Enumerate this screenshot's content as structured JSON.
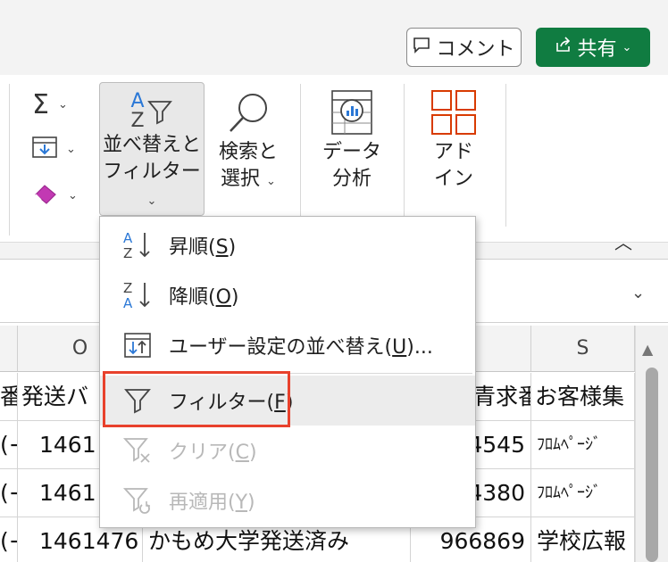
{
  "header": {
    "comment_label": "コメント",
    "share_label": "共有"
  },
  "ribbon": {
    "sort_filter_label": "並べ替えと",
    "sort_filter_label2": "フィルター",
    "find_select_label": "検索と",
    "find_select_label2": "選択",
    "analyze_label": "データ",
    "analyze_label2": "分析",
    "addins_label": "アド",
    "addins_label2": "イン",
    "sigma_glyph": "Σ",
    "sort_icon_top": "A",
    "sort_icon_bottom": "Z"
  },
  "menu": {
    "items": [
      {
        "label_pre": "昇順(",
        "key": "S",
        "label_post": ")",
        "icon": "sort-ascending-icon",
        "enabled": true
      },
      {
        "label_pre": "降順(",
        "key": "O",
        "label_post": ")",
        "icon": "sort-descending-icon",
        "enabled": true
      },
      {
        "label_pre": "ユーザー設定の並べ替え(",
        "key": "U",
        "label_post": ")...",
        "icon": "custom-sort-icon",
        "enabled": true
      },
      {
        "label_pre": "フィルター(",
        "key": "F",
        "label_post": ")",
        "icon": "filter-icon",
        "enabled": true
      },
      {
        "label_pre": "クリア(",
        "key": "C",
        "label_post": ")",
        "icon": "clear-filter-icon",
        "enabled": false
      },
      {
        "label_pre": "再適用(",
        "key": "Y",
        "label_post": ")",
        "icon": "reapply-filter-icon",
        "enabled": false
      }
    ]
  },
  "grid": {
    "columns": [
      "O",
      "S"
    ],
    "header_row": {
      "a": "番",
      "b": "発送バ",
      "c": "青求番",
      "d": "お客様集"
    },
    "rows": [
      {
        "a": "(+",
        "b": "1461",
        "c": "4545",
        "d": "ﾌﾛﾑﾍﾟｰｼﾞ"
      },
      {
        "a": "(+",
        "b": "1461",
        "c": "4380",
        "d": "ﾌﾛﾑﾍﾟｰｼﾞ"
      },
      {
        "a": "(+",
        "b": "1461476",
        "mid": "かもめ大学発送済み",
        "c": "966869",
        "d": "学校広報"
      }
    ]
  },
  "colors": {
    "accent_green": "#107c41",
    "highlight_red": "#e8412c",
    "addins_red": "#d83b01"
  }
}
